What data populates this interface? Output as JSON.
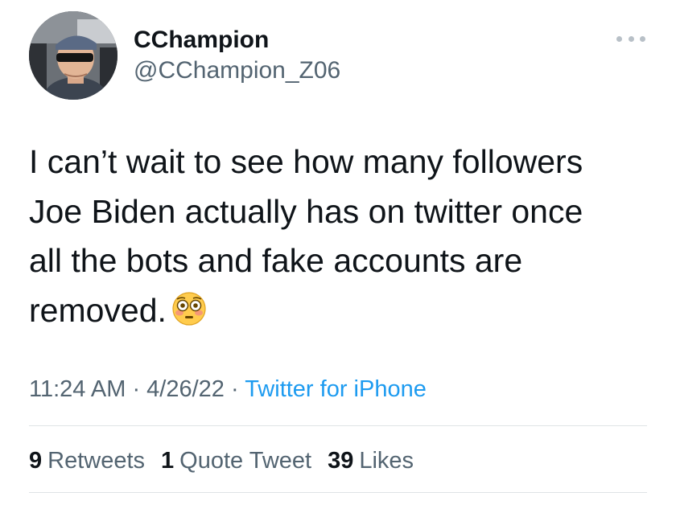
{
  "author": {
    "display_name": "CChampion",
    "handle": "@CChampion_Z06"
  },
  "tweet": {
    "text": "I can’t wait to see how many followers\nJoe Biden actually has on twitter once\nall the bots and fake accounts are\nremoved.",
    "emoji": "flushed-face"
  },
  "meta": {
    "time": "11:24 AM",
    "separator1": " · ",
    "date": "4/26/22",
    "separator2": " · ",
    "source": "Twitter for iPhone"
  },
  "stats": {
    "retweets_count": "9",
    "retweets_label": "Retweets",
    "quotes_count": "1",
    "quotes_label": "Quote Tweet",
    "likes_count": "39",
    "likes_label": "Likes"
  },
  "colors": {
    "text_primary": "#0f1419",
    "text_secondary": "#536471",
    "link": "#1d9bf0",
    "divider": "#dfe3e6"
  }
}
